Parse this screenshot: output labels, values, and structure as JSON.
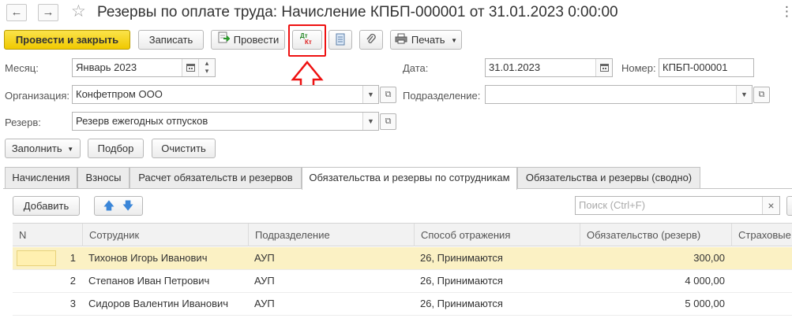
{
  "window": {
    "title": "Резервы по оплате труда: Начисление КПБП-000001 от 31.01.2023 0:00:00",
    "more_glyph": "⋮",
    "back_glyph": "←",
    "forward_glyph": "→",
    "star_glyph": "☆"
  },
  "toolbar": {
    "post_close_label": "Провести и закрыть",
    "save_label": "Записать",
    "post_label": "Провести",
    "dt_label": "Дт",
    "kt_label": "Кт",
    "print_label": "Печать"
  },
  "form": {
    "month": {
      "label": "Месяц:",
      "value": "Январь 2023"
    },
    "date": {
      "label": "Дата:",
      "value": "31.01.2023"
    },
    "number": {
      "label": "Номер:",
      "value": "КПБП-000001"
    },
    "organization": {
      "label": "Организация:",
      "value": "Конфетпром ООО"
    },
    "department": {
      "label": "Подразделение:",
      "value": ""
    },
    "reserve": {
      "label": "Резерв:",
      "value": "Резерв ежегодных отпусков"
    }
  },
  "actions": {
    "fill_label": "Заполнить",
    "pick_label": "Подбор",
    "clear_label": "Очистить"
  },
  "tabs": [
    {
      "label": "Начисления",
      "active": false
    },
    {
      "label": "Взносы",
      "active": false
    },
    {
      "label": "Расчет обязательств и резервов",
      "active": false
    },
    {
      "label": "Обязательства и резервы по сотрудникам",
      "active": true
    },
    {
      "label": "Обязательства и резервы (сводно)",
      "active": false
    }
  ],
  "table_toolbar": {
    "add_label": "Добавить",
    "search_placeholder": "Поиск (Ctrl+F)",
    "clear_glyph": "×"
  },
  "table": {
    "columns": [
      "N",
      "Сотрудник",
      "Подразделение",
      "Способ отражения",
      "Обязательство (резерв)",
      "Страховые"
    ],
    "rows": [
      {
        "n": "1",
        "employee": "Тихонов Игорь Иванович",
        "department": "АУП",
        "method": "26, Принимаются",
        "amount": "300,00",
        "selected": true
      },
      {
        "n": "2",
        "employee": "Степанов Иван Петрович",
        "department": "АУП",
        "method": "26, Принимаются",
        "amount": "4 000,00",
        "selected": false
      },
      {
        "n": "3",
        "employee": "Сидоров Валентин Иванович",
        "department": "АУП",
        "method": "26, Принимаются",
        "amount": "5 000,00",
        "selected": false
      }
    ]
  },
  "colors": {
    "primary_button": "#f6d21a",
    "annotation_red": "#e11111",
    "selected_row": "#fbf1c4",
    "arrow_blue": "#3b86d8"
  }
}
